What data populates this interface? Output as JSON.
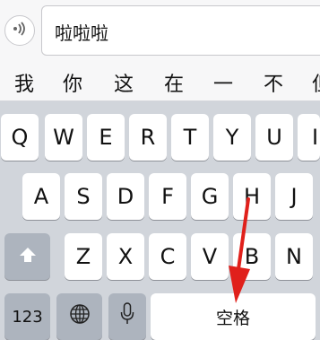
{
  "input": {
    "text": "啦啦啦"
  },
  "candidates": [
    "我",
    "你",
    "这",
    "在",
    "一",
    "不",
    "但"
  ],
  "keyboard": {
    "row1": [
      "Q",
      "W",
      "E",
      "R",
      "T",
      "Y",
      "U",
      "I"
    ],
    "row2": [
      "A",
      "S",
      "D",
      "F",
      "G",
      "H",
      "J"
    ],
    "row3": [
      "Z",
      "X",
      "C",
      "V",
      "B",
      "N"
    ],
    "numbers_label": "123",
    "space_label": "空格"
  },
  "icons": {
    "voice": "voice-wave-icon",
    "shift": "shift-arrow-icon",
    "globe": "globe-icon",
    "mic": "microphone-icon",
    "annotation": "red-arrow"
  },
  "colors": {
    "key": "#ffffff",
    "key_dark": "#adb4be",
    "keyboard_bg": "#d1d5db",
    "annotation": "#e0201b"
  }
}
